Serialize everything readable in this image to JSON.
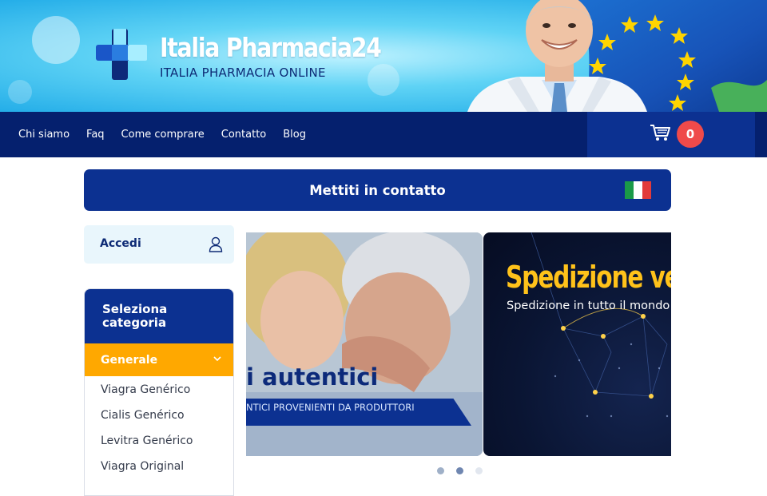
{
  "header": {
    "brand_title": "Italia Pharmacia24",
    "brand_subtitle": "ITALIA PHARMACIA ONLINE"
  },
  "nav": {
    "links": [
      "Chi siamo",
      "Faq",
      "Come comprare",
      "Contatto",
      "Blog"
    ],
    "cart_count": "0"
  },
  "contact_bar": {
    "label": "Mettiti in contatto"
  },
  "sidebar": {
    "login_label": "Accedi",
    "category_heading": "Seleziona categoria",
    "active_category": "Generale",
    "items": [
      "Viagra Genérico",
      "Cialis Genérico",
      "Levitra Genérico",
      "Viagra Original"
    ]
  },
  "carousel": {
    "slide1_heading": "i autentici",
    "slide1_sub": "NTICI PROVENIENTI DA PRODUTTORI",
    "slide2_heading": "Spedizione vel",
    "slide2_sub": "Spedizione in tutto il mondo",
    "active_dot": 2,
    "dot_count": 3
  },
  "colors": {
    "navy": "#05206e",
    "brand_blue": "#0c3191",
    "accent_orange": "#ffa800",
    "cart_badge_red": "#ef4a4a",
    "slide_gold": "#ffc21a"
  },
  "icons": [
    "medical-cross-logo-icon",
    "cart-icon",
    "user-icon",
    "chevron-down-icon",
    "italy-flag-icon"
  ]
}
